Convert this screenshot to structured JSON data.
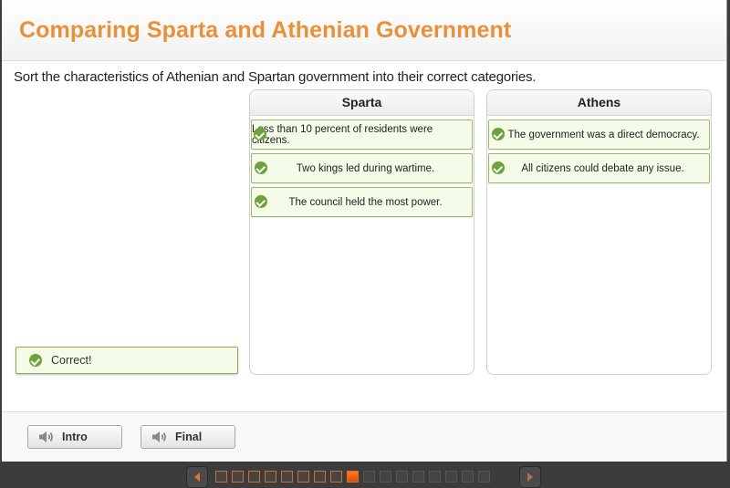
{
  "header": {
    "title": "Comparing Sparta and Athenian Government"
  },
  "instructions": "Sort the characteristics of Athenian and Spartan government into their correct categories.",
  "columns": [
    {
      "title": "Sparta",
      "items": [
        {
          "text": "Less than 10 percent of residents were citizens.",
          "status": "correct"
        },
        {
          "text": "Two kings led during wartime.",
          "status": "correct"
        },
        {
          "text": "The council held the most power.",
          "status": "correct"
        }
      ]
    },
    {
      "title": "Athens",
      "items": [
        {
          "text": "The government was a direct democracy.",
          "status": "correct"
        },
        {
          "text": "All citizens could debate any issue.",
          "status": "correct"
        }
      ]
    }
  ],
  "feedback": {
    "text": "Correct!",
    "icon": "check-circle-icon"
  },
  "audio_buttons": [
    {
      "label": "Intro",
      "icon": "speaker-icon"
    },
    {
      "label": "Final",
      "icon": "speaker-icon"
    }
  ],
  "pagination": {
    "total": 17,
    "current": 9,
    "visited_count": 8
  },
  "colors": {
    "title": "#e8913a",
    "correct_green": "#6ea23a",
    "correct_bg": "#f5fbe9",
    "current_page": "#e86a1a"
  }
}
